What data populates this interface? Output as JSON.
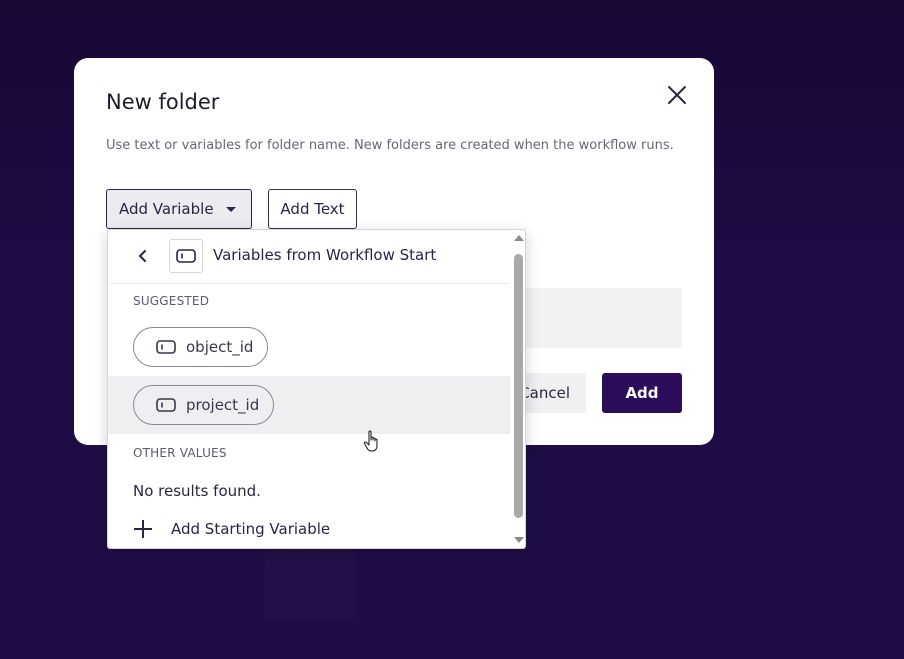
{
  "modal": {
    "title": "New folder",
    "description": "Use text or variables for folder name. New folders are created when the workflow runs.",
    "add_variable_label": "Add Variable",
    "add_text_label": "Add Text",
    "cancel_label": "Cancel",
    "add_label": "Add",
    "close_icon": "close-icon"
  },
  "dropdown": {
    "header_title": "Variables from Workflow Start",
    "suggested_heading": "SUGGESTED",
    "suggested": [
      {
        "label": "object_id"
      },
      {
        "label": "project_id"
      }
    ],
    "other_heading": "OTHER VALUES",
    "empty_text": "No results found.",
    "add_starting_label": "Add Starting Variable"
  },
  "colors": {
    "backdrop": "#1e0c44",
    "primary": "#2a0e5c",
    "hover_row": "#efeff1"
  }
}
